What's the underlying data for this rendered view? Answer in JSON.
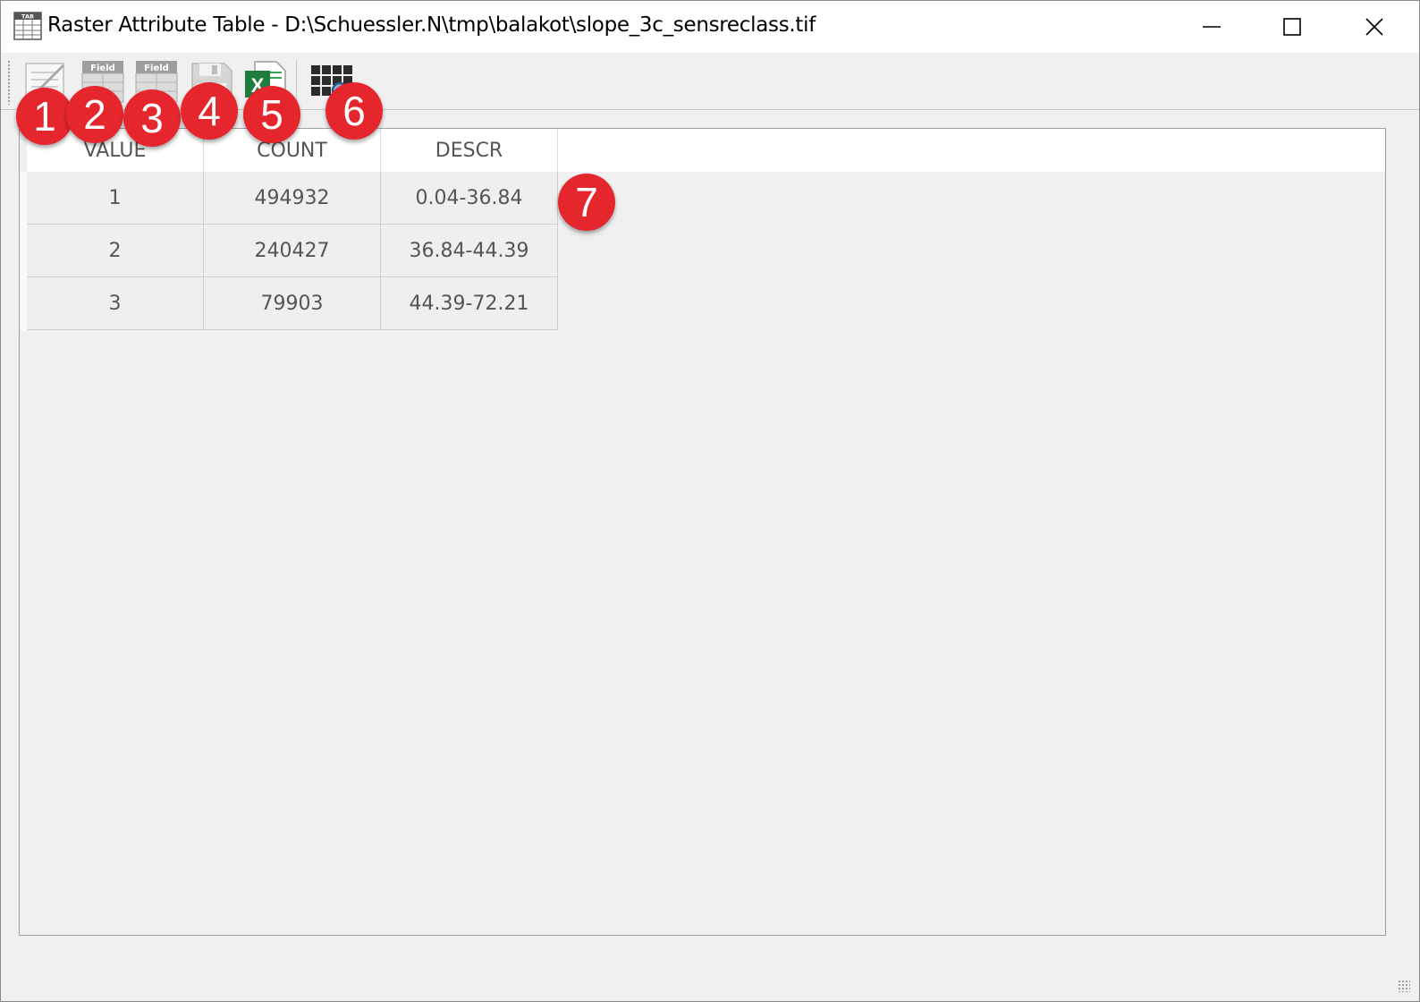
{
  "window": {
    "title": "Raster Attribute Table - D:\\Schuessler.N\\tmp\\balakot\\slope_3c_sensreclass.tif",
    "icon_label": "TAB"
  },
  "toolbar": {
    "buttons": [
      {
        "name": "edit-table",
        "icon": "edit-icon"
      },
      {
        "name": "add-field",
        "icon": "add-field-icon",
        "label": "Field"
      },
      {
        "name": "delete-field",
        "icon": "delete-field-icon",
        "label": "Field"
      },
      {
        "name": "save",
        "icon": "save-icon"
      },
      {
        "name": "export-excel",
        "icon": "excel-icon",
        "label": "X"
      },
      {
        "name": "zoom-raster",
        "icon": "raster-zoom-icon"
      }
    ]
  },
  "table": {
    "columns": [
      "VALUE",
      "COUNT",
      "DESCR"
    ],
    "rows": [
      [
        "1",
        "494932",
        "0.04-36.84"
      ],
      [
        "2",
        "240427",
        "36.84-44.39"
      ],
      [
        "3",
        "79903",
        "44.39-72.21"
      ]
    ]
  },
  "annotations": [
    "1",
    "2",
    "3",
    "4",
    "5",
    "6",
    "7"
  ],
  "colors": {
    "badge": "#e5272d",
    "excel_green": "#1e7d3c"
  }
}
